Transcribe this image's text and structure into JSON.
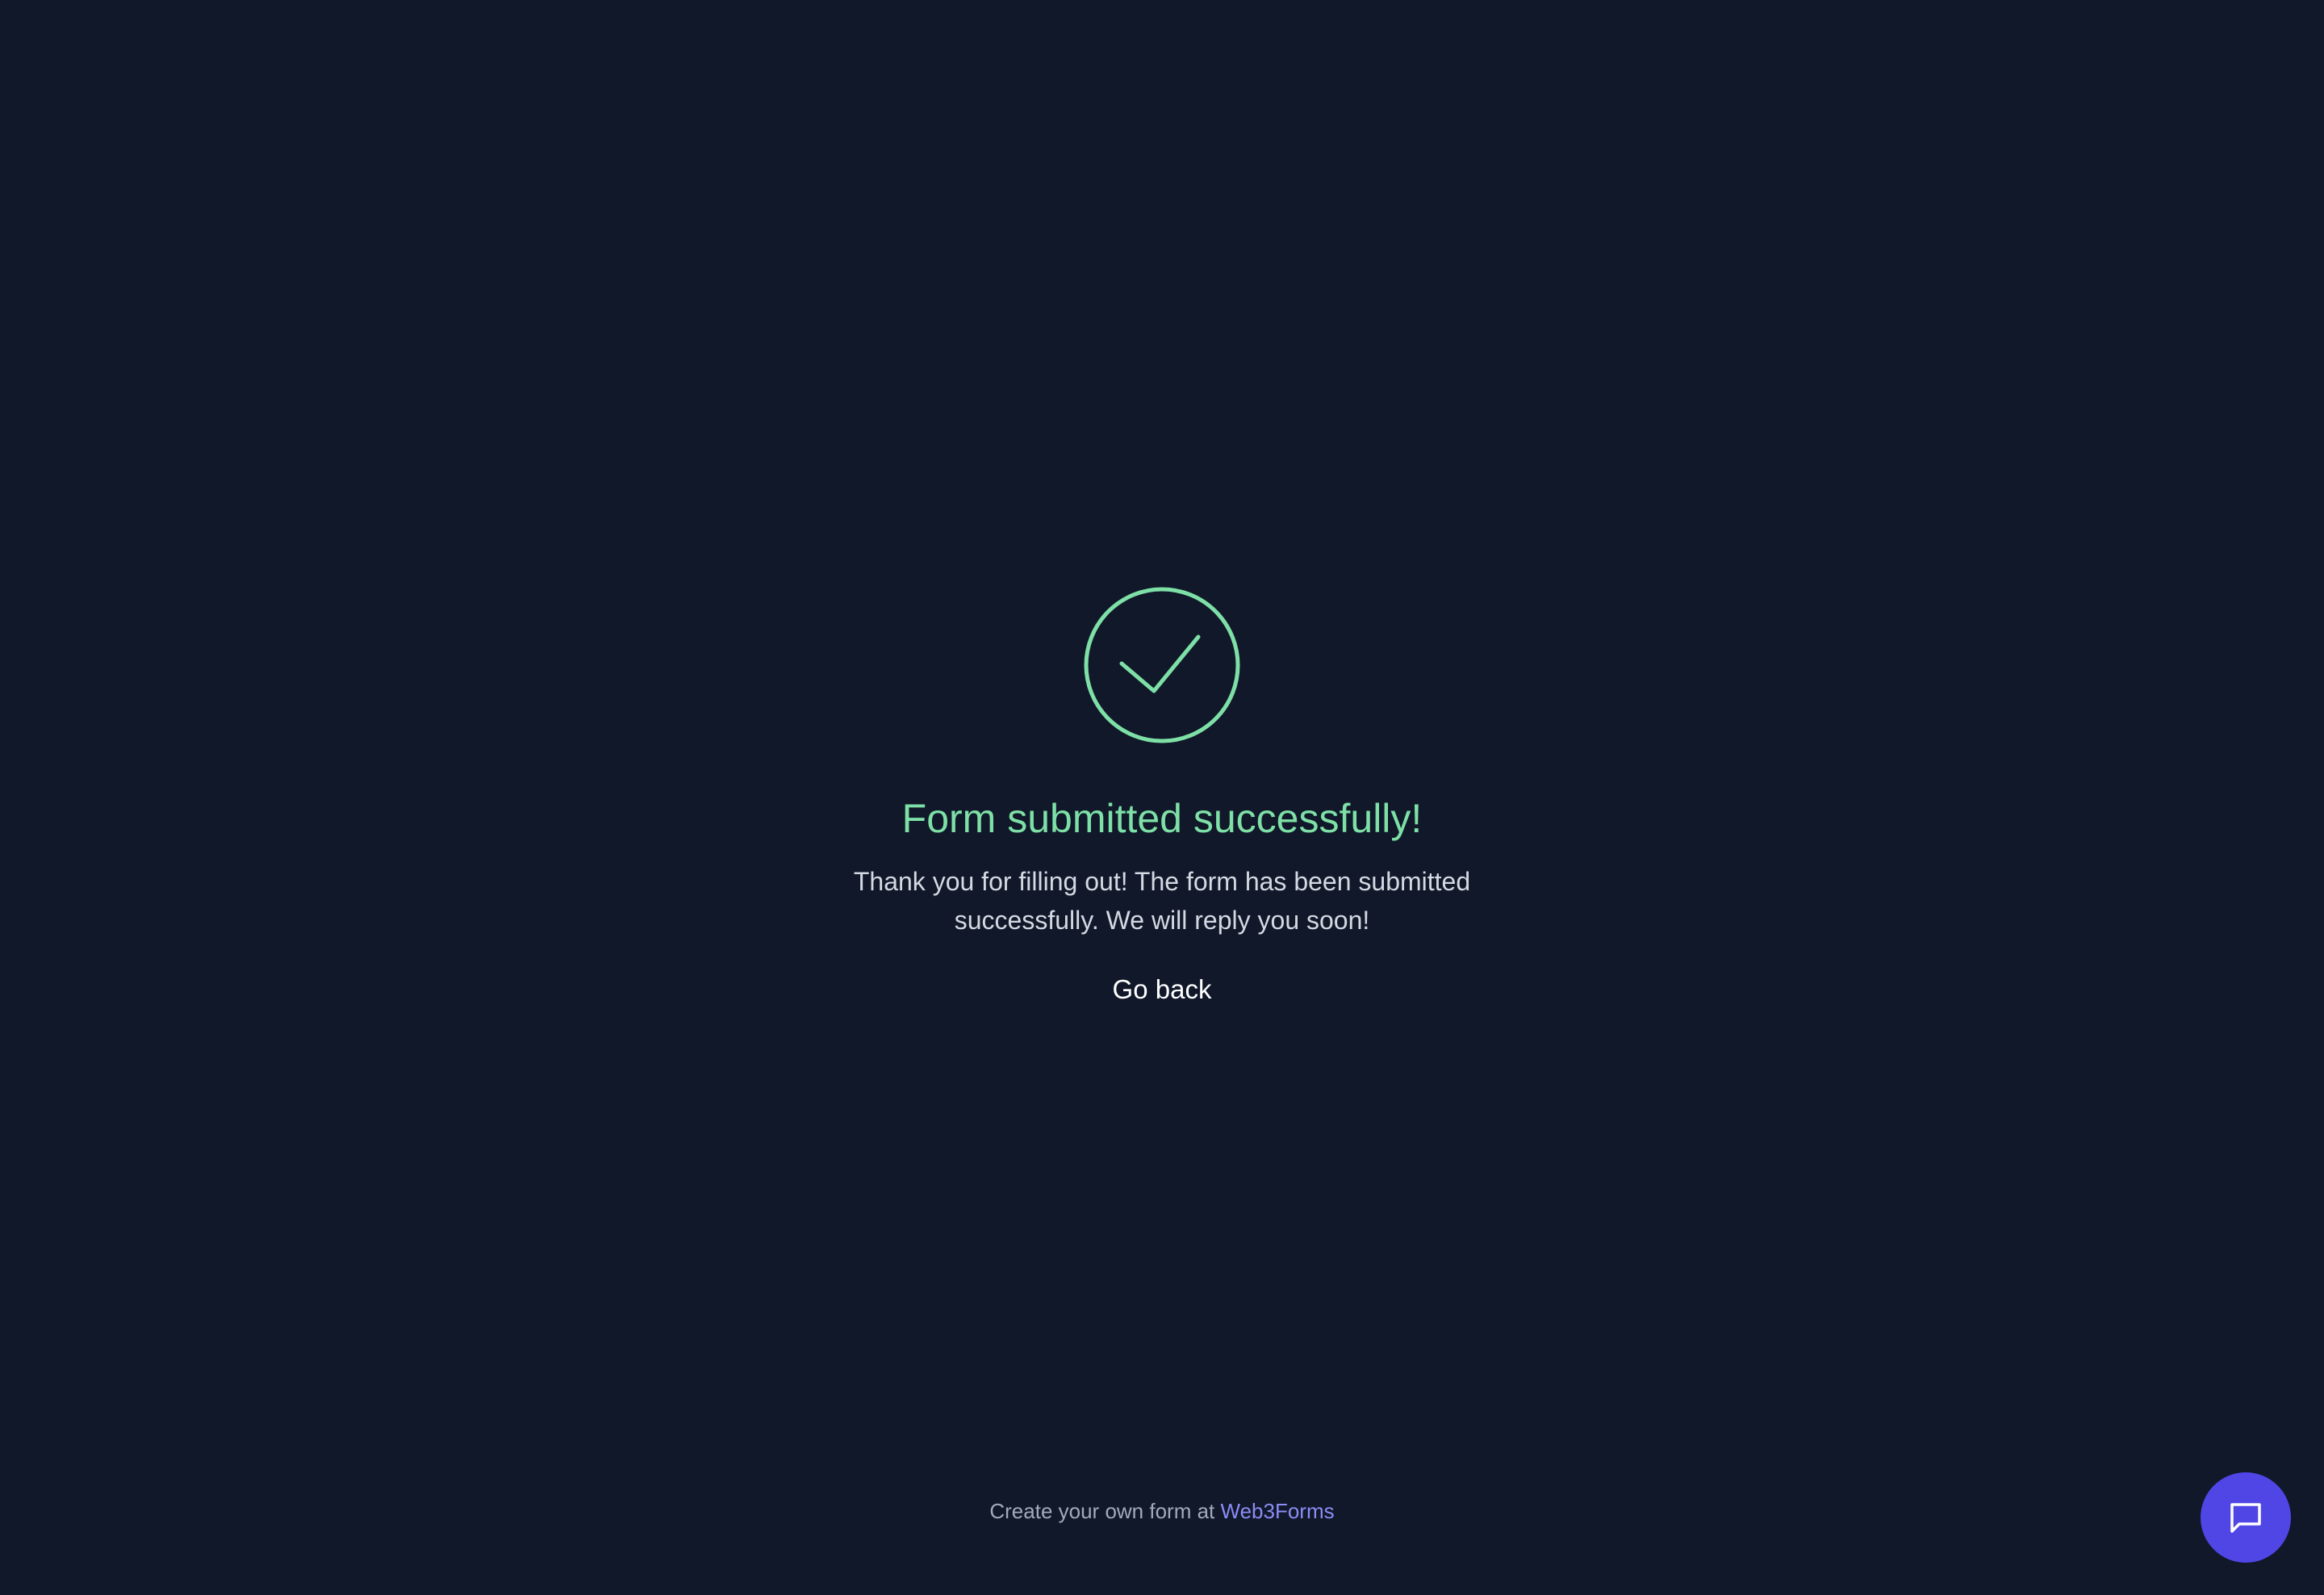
{
  "colors": {
    "background": "#10182a",
    "success": "#7ee0a6",
    "message_text": "#d4d9e2",
    "link": "#8b8cf4",
    "chat_button": "#4f46e5"
  },
  "success": {
    "icon": "check-circle-icon",
    "title": "Form submitted successfully!",
    "message": "Thank you for filling out! The form has been submitted successfully. We will reply you soon!",
    "go_back_label": "Go back"
  },
  "footer": {
    "prefix": "Create your own form at",
    "link_label": "Web3Forms"
  },
  "chat": {
    "icon": "chat-bubble-icon"
  }
}
